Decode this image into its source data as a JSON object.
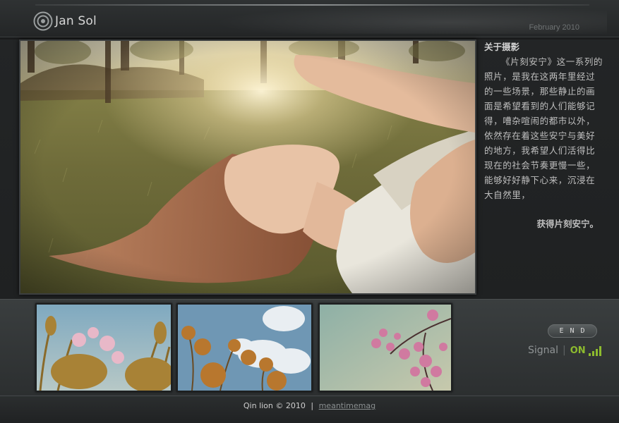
{
  "header": {
    "author": "Jan Sol",
    "date": "February 2010"
  },
  "article": {
    "title": "关于摄影",
    "body": "《片刻安宁》这一系列的照片，是我在这两年里经过的一些场景，那些静止的画面是希望看到的人们能够记得，嘈杂喧闹的都市以外，依然存在着这些安宁与美好的地方，我希望人们活得比现在的社会节奏更慢一些，能够好好静下心来，沉浸在大自然里，",
    "signature": "获得片刻安宁。"
  },
  "controls": {
    "end_label": "END",
    "signal_label": "Signal",
    "signal_state": "ON"
  },
  "footer": {
    "copyright": "Qin lion © 2010",
    "separator": "|",
    "link": "meantimemag"
  },
  "colors": {
    "background": "#1c1e1f",
    "accent_green": "#8dbb2e",
    "text": "#c8c8c8"
  },
  "icons": [
    "circle-logo-icon",
    "signal-bars-icon"
  ]
}
